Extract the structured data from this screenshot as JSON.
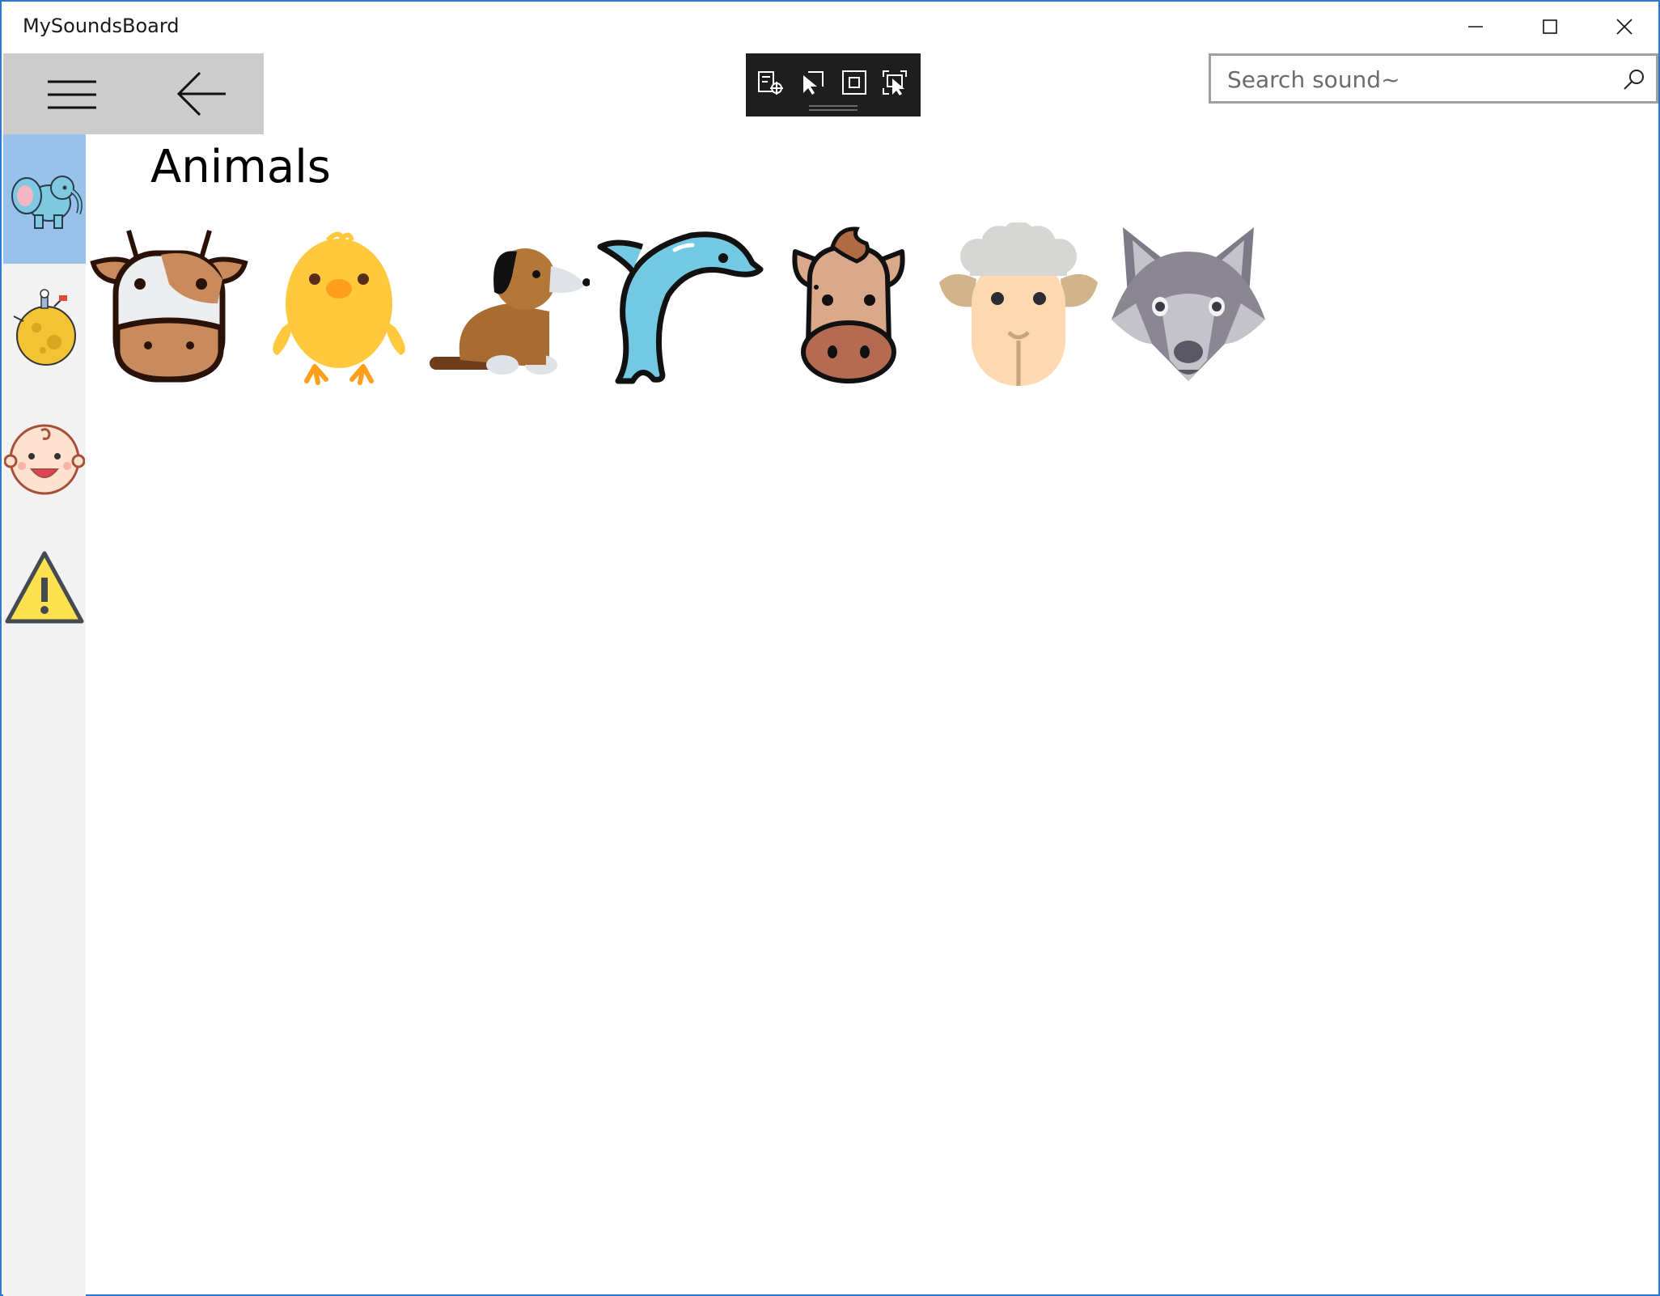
{
  "window": {
    "title": "MySoundsBoard"
  },
  "search": {
    "placeholder": "Search sound~",
    "value": ""
  },
  "navbar": {
    "menu_icon": "hamburger-icon",
    "back_icon": "back-arrow-icon"
  },
  "debug_toolbar": {
    "icons": [
      "live-visual-tree-icon",
      "select-element-icon",
      "display-layout-adorners-icon",
      "track-focus-icon"
    ]
  },
  "categories": [
    {
      "icon": "elephant-icon",
      "selected": true
    },
    {
      "icon": "moon-planet-icon",
      "selected": false
    },
    {
      "icon": "baby-face-icon",
      "selected": false
    },
    {
      "icon": "warning-sign-icon",
      "selected": false
    }
  ],
  "page": {
    "title": "Animals"
  },
  "sounds": [
    {
      "icon": "cow-icon"
    },
    {
      "icon": "chick-icon"
    },
    {
      "icon": "dog-icon"
    },
    {
      "icon": "dolphin-icon"
    },
    {
      "icon": "horse-icon"
    },
    {
      "icon": "sheep-icon"
    },
    {
      "icon": "wolf-icon"
    }
  ],
  "colors": {
    "selected_category_bg": "#99c2ea",
    "rail_bg": "#f2f2f2",
    "navbar_bg": "#cccccc",
    "debug_toolbar_bg": "#1e1e1e",
    "window_border": "#2b79d0"
  }
}
